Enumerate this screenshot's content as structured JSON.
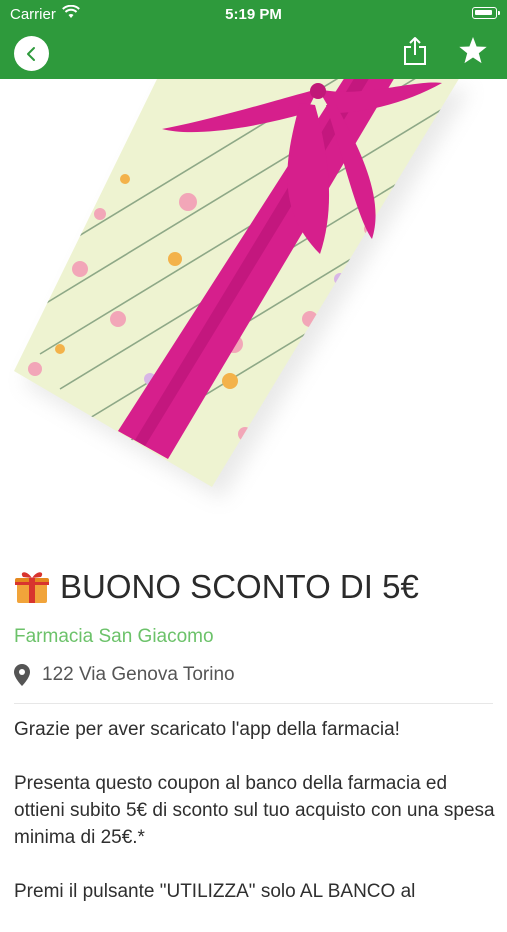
{
  "status_bar": {
    "carrier": "Carrier",
    "time": "5:19 PM"
  },
  "nav": {
    "back_icon": "chevron-left-icon",
    "share_icon": "share-icon",
    "favorite_icon": "star-icon"
  },
  "colors": {
    "brand_green": "#2e9a3c",
    "pharmacy_green": "#6cc26a",
    "ribbon": "#d61f8c"
  },
  "coupon": {
    "title": "BUONO SCONTO DI 5€",
    "pharmacy_name": "Farmacia San Giacomo",
    "address": "122 Via Genova Torino",
    "description": [
      "Grazie per aver scaricato l'app della farmacia!",
      "Presenta questo coupon al banco della farmacia ed ottieni subito 5€ di sconto sul tuo acquisto con una spesa minima di 25€.*",
      "Premi il pulsante \"UTILIZZA\" solo AL BANCO al"
    ]
  }
}
